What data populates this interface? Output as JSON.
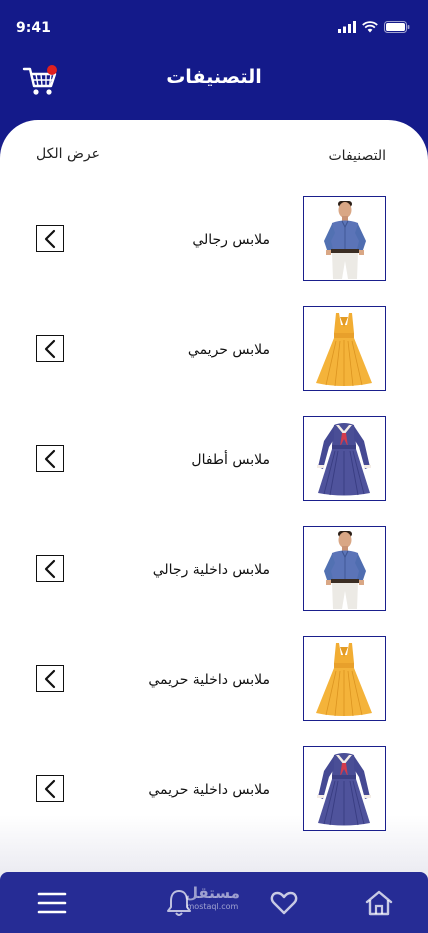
{
  "status_bar": {
    "time": "9:41"
  },
  "header": {
    "title": "التصنيفات"
  },
  "section": {
    "title": "التصنيفات",
    "view_all": "عرض الكل"
  },
  "categories": [
    {
      "label": "ملابس رجالي",
      "image": "man-shirt"
    },
    {
      "label": "ملابس حريمي",
      "image": "yellow-dress"
    },
    {
      "label": "ملابس أطفال",
      "image": "navy-dress"
    },
    {
      "label": "ملابس داخلية رجالي",
      "image": "man-shirt"
    },
    {
      "label": "ملابس داخلية حريمي",
      "image": "yellow-dress"
    },
    {
      "label": "ملابس داخلية حريمي",
      "image": "navy-dress"
    }
  ],
  "watermark": {
    "main": "مستقل",
    "sub": "mostaql.com"
  },
  "colors": {
    "primary": "#141a8a",
    "nav": "#262c95",
    "badge": "#e02020"
  }
}
